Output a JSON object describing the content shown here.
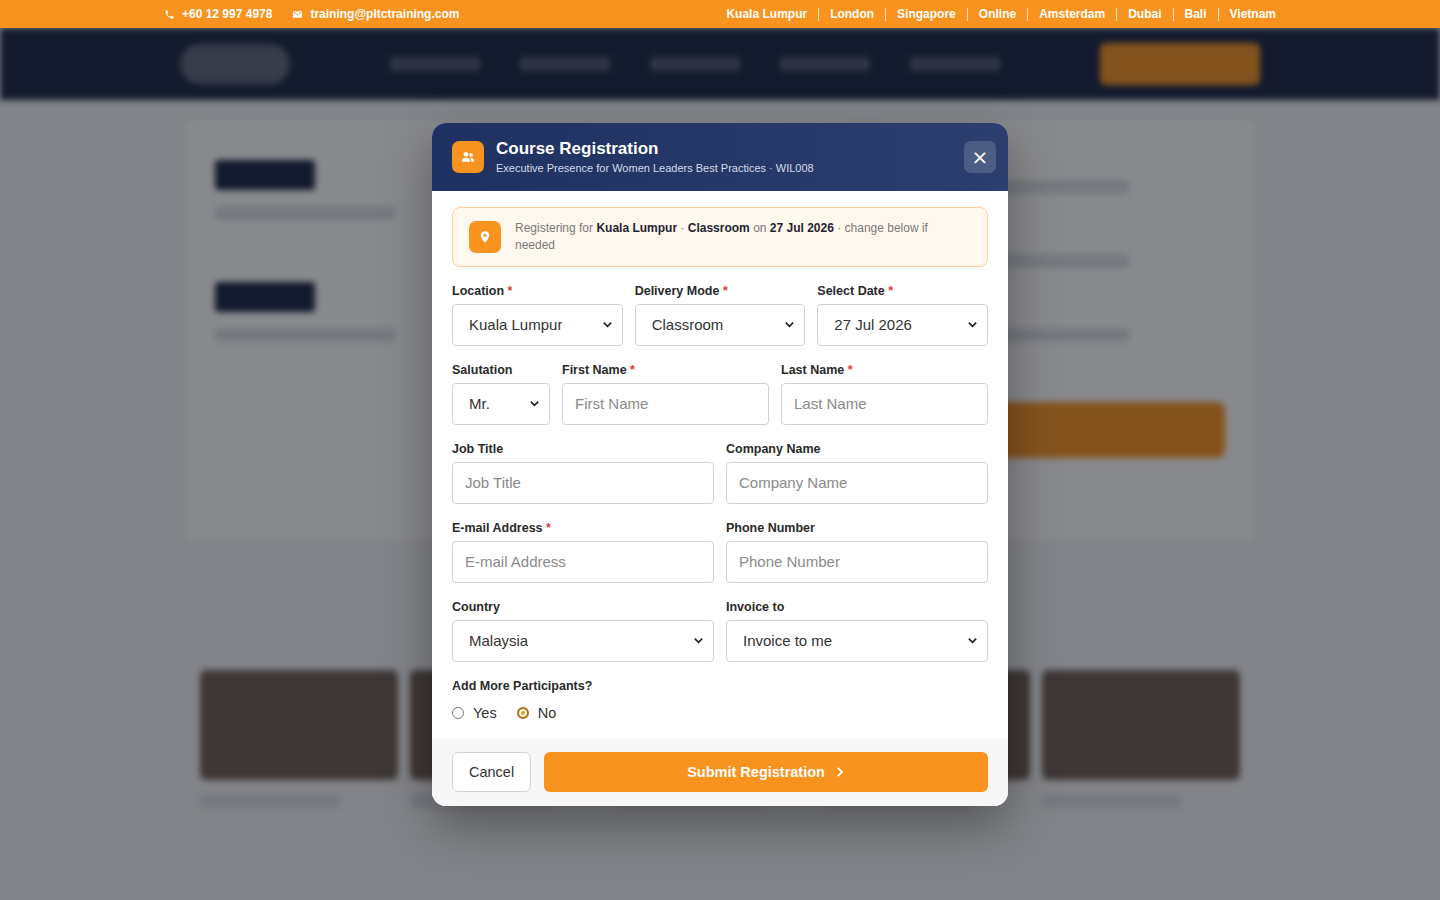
{
  "topbar": {
    "phone": "+60 12 997 4978",
    "email": "training@pltctraining.com",
    "locations": [
      "Kuala Lumpur",
      "London",
      "Singapore",
      "Online",
      "Amsterdam",
      "Dubai",
      "Bali",
      "Vietnam"
    ]
  },
  "modal": {
    "title": "Course Registration",
    "subtitle": "Executive Presence for Women Leaders Best Practices · WIL008",
    "close": "×",
    "notice": [
      {
        "text": "Registering for",
        "bold": false
      },
      {
        "text": "Kuala Lumpur",
        "bold": true
      },
      {
        "text": "·",
        "bold": false
      },
      {
        "text": "Classroom",
        "bold": true
      },
      {
        "text": "on",
        "bold": false
      },
      {
        "text": "27 Jul 2026",
        "bold": true
      },
      {
        "text": "· change below if needed",
        "bold": false
      }
    ],
    "required_mark": "*",
    "rows": [
      [
        {
          "label": "Location",
          "required": true,
          "kind": "select",
          "value": "Kuala Lumpur"
        },
        {
          "label": "Delivery Mode",
          "required": true,
          "kind": "select",
          "value": "Classroom"
        },
        {
          "label": "Select Date",
          "required": true,
          "kind": "select",
          "value": "27 Jul 2026"
        }
      ],
      [
        {
          "label": "Salutation",
          "required": false,
          "kind": "select",
          "value": "Mr."
        },
        {
          "label": "First Name",
          "required": true,
          "kind": "input",
          "placeholder": "First Name"
        },
        {
          "label": "Last Name",
          "required": true,
          "kind": "input",
          "placeholder": "Last Name"
        }
      ],
      [
        {
          "label": "Job Title",
          "required": false,
          "kind": "input",
          "placeholder": "Job Title"
        },
        {
          "label": "Company Name",
          "required": false,
          "kind": "input",
          "placeholder": "Company Name"
        }
      ],
      [
        {
          "label": "E-mail Address",
          "required": true,
          "kind": "input",
          "placeholder": "E-mail Address"
        },
        {
          "label": "Phone Number",
          "required": false,
          "kind": "input",
          "placeholder": "Phone Number"
        }
      ],
      [
        {
          "label": "Country",
          "required": false,
          "kind": "select",
          "value": "Malaysia"
        },
        {
          "label": "Invoice to",
          "required": false,
          "kind": "select",
          "value": "Invoice to me"
        }
      ]
    ],
    "participants": {
      "label": "Add More Participants?",
      "options": [
        {
          "label": "Yes",
          "selected": false
        },
        {
          "label": "No",
          "selected": true
        }
      ]
    },
    "buttons": {
      "cancel": "Cancel",
      "submit": "Submit Registration"
    }
  }
}
